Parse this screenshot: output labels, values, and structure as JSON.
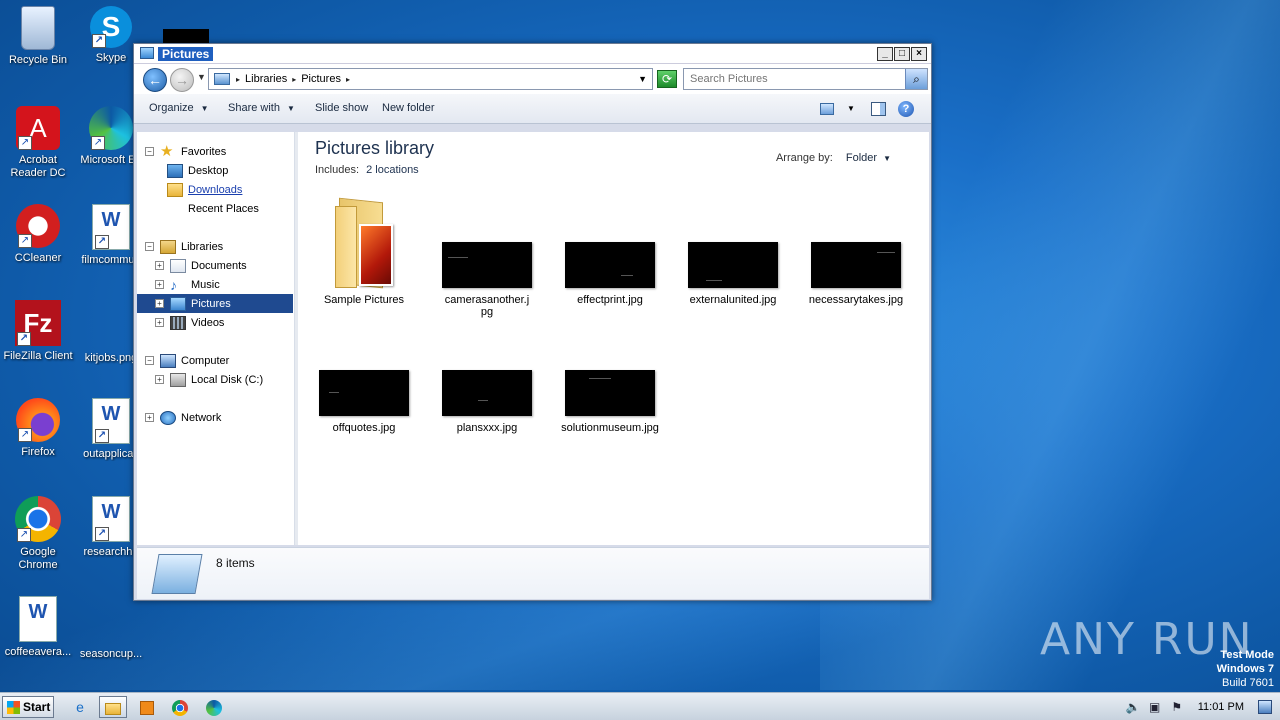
{
  "desktop": {
    "icons": [
      {
        "label": "Recycle Bin"
      },
      {
        "label": "Skype"
      },
      {
        "label": "Acrobat Reader DC"
      },
      {
        "label": "Microsoft Ed"
      },
      {
        "label": "CCleaner"
      },
      {
        "label": "filmcommun"
      },
      {
        "label": "FileZilla Client"
      },
      {
        "label": "kitjobs.png"
      },
      {
        "label": "Firefox"
      },
      {
        "label": "outapplicati"
      },
      {
        "label": "Google Chrome"
      },
      {
        "label": "researchhu"
      },
      {
        "label": "coffeeavera..."
      },
      {
        "label": "seasoncup..."
      }
    ],
    "watermark": "ANY RUN",
    "test_mode": {
      "line1": "Test Mode",
      "line2": "Windows 7",
      "line3": "Build 7601"
    }
  },
  "window": {
    "title": "Pictures",
    "controls": {
      "minimize": "_",
      "maximize": "□",
      "close": "×"
    },
    "address": {
      "crumbs": [
        "Libraries",
        "Pictures"
      ]
    },
    "search": {
      "placeholder": "Search Pictures"
    },
    "toolbar": {
      "organize": "Organize",
      "share_with": "Share with",
      "slide_show": "Slide show",
      "new_folder": "New folder"
    },
    "nav": {
      "favorites": "Favorites",
      "desktop": "Desktop",
      "downloads": "Downloads",
      "recent_places": "Recent Places",
      "libraries": "Libraries",
      "documents": "Documents",
      "music": "Music",
      "pictures": "Pictures",
      "videos": "Videos",
      "computer": "Computer",
      "local_disk": "Local Disk (C:)",
      "network": "Network"
    },
    "content": {
      "title": "Pictures library",
      "includes_label": "Includes:",
      "includes_value": "2 locations",
      "arrange_label": "Arrange by:",
      "arrange_value": "Folder",
      "items": [
        {
          "name": "Sample Pictures",
          "kind": "folder"
        },
        {
          "name": "camerasanother.jpg",
          "kind": "image"
        },
        {
          "name": "effectprint.jpg",
          "kind": "image"
        },
        {
          "name": "externalunited.jpg",
          "kind": "image"
        },
        {
          "name": "necessarytakes.jpg",
          "kind": "image"
        },
        {
          "name": "offquotes.jpg",
          "kind": "image"
        },
        {
          "name": "plansxxx.jpg",
          "kind": "image"
        },
        {
          "name": "solutionmuseum.jpg",
          "kind": "image"
        }
      ]
    },
    "details": {
      "count": "8 items"
    }
  },
  "taskbar": {
    "start": "Start",
    "clock": "11:01 PM"
  }
}
